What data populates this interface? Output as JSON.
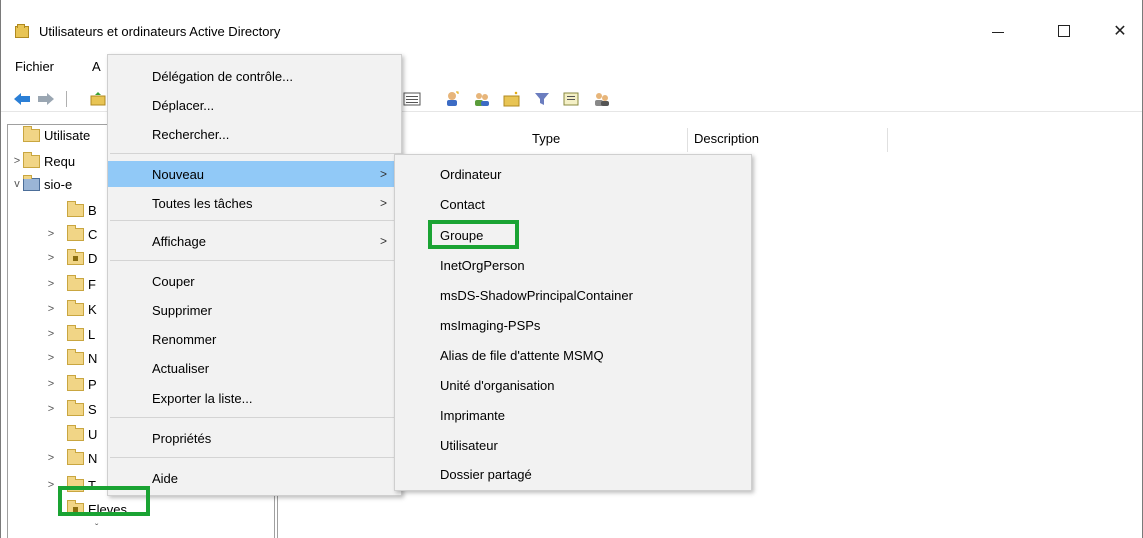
{
  "window": {
    "title": "Utilisateurs et ordinateurs Active Directory",
    "icon": "folder-app-icon",
    "controls": [
      "minimize",
      "maximize",
      "close"
    ]
  },
  "menubar": {
    "items": [
      {
        "label": "Fichier"
      },
      {
        "label": "A"
      }
    ]
  },
  "toolbar": {
    "icons": [
      "back-arrow-icon",
      "forward-arrow-icon",
      "up-folder-icon",
      "details-view-icon",
      "add-user-icon",
      "add-group-icon",
      "new-ou-icon",
      "filter-icon",
      "find-icon",
      "delegate-icon"
    ]
  },
  "list": {
    "columns": [
      {
        "label": "Type"
      },
      {
        "label": "Description"
      }
    ]
  },
  "tree": {
    "items": [
      {
        "label": "Utilisate",
        "chev": "",
        "icon": "root"
      },
      {
        "label": "Requ",
        "chev": ">",
        "icon": "folder"
      },
      {
        "label": "sio-e",
        "chev": "v",
        "icon": "domain"
      },
      {
        "label": "B",
        "chev": "",
        "icon": "folder"
      },
      {
        "label": "C",
        "chev": ">",
        "icon": "folder"
      },
      {
        "label": "D",
        "chev": ">",
        "icon": "special"
      },
      {
        "label": "F",
        "chev": ">",
        "icon": "folder"
      },
      {
        "label": "K",
        "chev": ">",
        "icon": "folder"
      },
      {
        "label": "L",
        "chev": ">",
        "icon": "folder"
      },
      {
        "label": "N",
        "chev": ">",
        "icon": "folder"
      },
      {
        "label": "P",
        "chev": ">",
        "icon": "folder"
      },
      {
        "label": "S",
        "chev": ">",
        "icon": "folder"
      },
      {
        "label": "U",
        "chev": "",
        "icon": "folder"
      },
      {
        "label": "N",
        "chev": ">",
        "icon": "folder"
      },
      {
        "label": "T",
        "chev": ">",
        "icon": "folder"
      },
      {
        "label": "Eleves",
        "chev": "",
        "icon": "special"
      }
    ]
  },
  "context_menu": {
    "items": [
      {
        "label": "Délégation de contrôle...",
        "arrow": ""
      },
      {
        "label": "Déplacer...",
        "arrow": ""
      },
      {
        "label": "Rechercher...",
        "arrow": ""
      },
      {
        "label": "Nouveau",
        "arrow": ">"
      },
      {
        "label": "Toutes les tâches",
        "arrow": ">"
      },
      {
        "label": "Affichage",
        "arrow": ">"
      },
      {
        "label": "Couper",
        "arrow": ""
      },
      {
        "label": "Supprimer",
        "arrow": ""
      },
      {
        "label": "Renommer",
        "arrow": ""
      },
      {
        "label": "Actualiser",
        "arrow": ""
      },
      {
        "label": "Exporter la liste...",
        "arrow": ""
      },
      {
        "label": "Propriétés",
        "arrow": ""
      },
      {
        "label": "Aide",
        "arrow": ""
      }
    ],
    "active": "Nouveau"
  },
  "submenu": {
    "items": [
      {
        "label": "Ordinateur"
      },
      {
        "label": "Contact"
      },
      {
        "label": "Groupe"
      },
      {
        "label": "InetOrgPerson"
      },
      {
        "label": "msDS-ShadowPrincipalContainer"
      },
      {
        "label": "msImaging-PSPs"
      },
      {
        "label": "Alias de file d'attente MSMQ"
      },
      {
        "label": "Unité d'organisation"
      },
      {
        "label": "Imprimante"
      },
      {
        "label": "Utilisateur"
      },
      {
        "label": "Dossier partagé"
      }
    ],
    "highlighted": "Groupe"
  },
  "colors": {
    "highlight_box": "#1aa333",
    "menu_active": "#91c9f7",
    "menu_bg": "#f2f2f2"
  }
}
